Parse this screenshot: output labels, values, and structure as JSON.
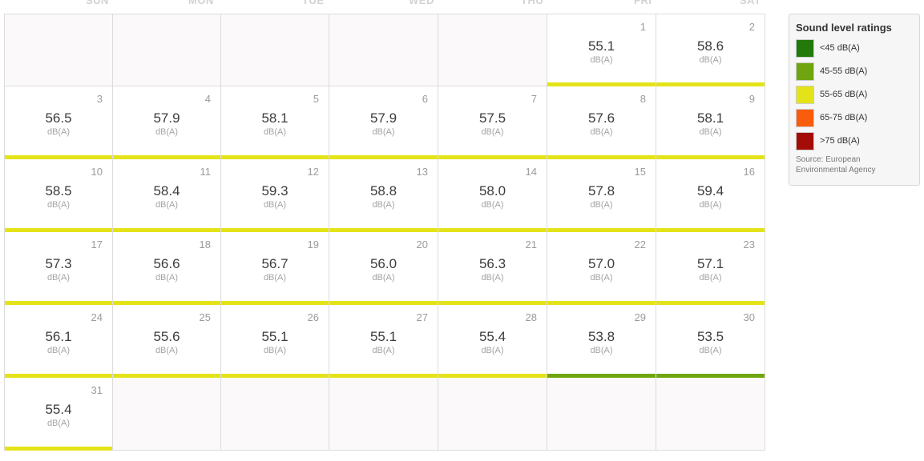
{
  "calendar": {
    "weekdays": [
      "SUN",
      "MON",
      "TUE",
      "WED",
      "THU",
      "FRI",
      "SAT"
    ],
    "unit": "dB(A)",
    "leading_blank_days": 5,
    "days": [
      {
        "day": "1",
        "value": "55.1",
        "rating": "55-65 dB(A)"
      },
      {
        "day": "2",
        "value": "58.6",
        "rating": "55-65 dB(A)"
      },
      {
        "day": "3",
        "value": "56.5",
        "rating": "55-65 dB(A)"
      },
      {
        "day": "4",
        "value": "57.9",
        "rating": "55-65 dB(A)"
      },
      {
        "day": "5",
        "value": "58.1",
        "rating": "55-65 dB(A)"
      },
      {
        "day": "6",
        "value": "57.9",
        "rating": "55-65 dB(A)"
      },
      {
        "day": "7",
        "value": "57.5",
        "rating": "55-65 dB(A)"
      },
      {
        "day": "8",
        "value": "57.6",
        "rating": "55-65 dB(A)"
      },
      {
        "day": "9",
        "value": "58.1",
        "rating": "55-65 dB(A)"
      },
      {
        "day": "10",
        "value": "58.5",
        "rating": "55-65 dB(A)"
      },
      {
        "day": "11",
        "value": "58.4",
        "rating": "55-65 dB(A)"
      },
      {
        "day": "12",
        "value": "59.3",
        "rating": "55-65 dB(A)"
      },
      {
        "day": "13",
        "value": "58.8",
        "rating": "55-65 dB(A)"
      },
      {
        "day": "14",
        "value": "58.0",
        "rating": "55-65 dB(A)"
      },
      {
        "day": "15",
        "value": "57.8",
        "rating": "55-65 dB(A)"
      },
      {
        "day": "16",
        "value": "59.4",
        "rating": "55-65 dB(A)"
      },
      {
        "day": "17",
        "value": "57.3",
        "rating": "55-65 dB(A)"
      },
      {
        "day": "18",
        "value": "56.6",
        "rating": "55-65 dB(A)"
      },
      {
        "day": "19",
        "value": "56.7",
        "rating": "55-65 dB(A)"
      },
      {
        "day": "20",
        "value": "56.0",
        "rating": "55-65 dB(A)"
      },
      {
        "day": "21",
        "value": "56.3",
        "rating": "55-65 dB(A)"
      },
      {
        "day": "22",
        "value": "57.0",
        "rating": "55-65 dB(A)"
      },
      {
        "day": "23",
        "value": "57.1",
        "rating": "55-65 dB(A)"
      },
      {
        "day": "24",
        "value": "56.1",
        "rating": "55-65 dB(A)"
      },
      {
        "day": "25",
        "value": "55.6",
        "rating": "55-65 dB(A)"
      },
      {
        "day": "26",
        "value": "55.1",
        "rating": "55-65 dB(A)"
      },
      {
        "day": "27",
        "value": "55.1",
        "rating": "55-65 dB(A)"
      },
      {
        "day": "28",
        "value": "55.4",
        "rating": "55-65 dB(A)"
      },
      {
        "day": "29",
        "value": "53.8",
        "rating": "45-55 dB(A)"
      },
      {
        "day": "30",
        "value": "53.5",
        "rating": "45-55 dB(A)"
      },
      {
        "day": "31",
        "value": "55.4",
        "rating": "55-65 dB(A)"
      }
    ]
  },
  "legend": {
    "title": "Sound level ratings",
    "items": [
      {
        "label": "<45 dB(A)",
        "color": "#237a0a"
      },
      {
        "label": "45-55 dB(A)",
        "color": "#6fa60f"
      },
      {
        "label": "55-65 dB(A)",
        "color": "#e4e319"
      },
      {
        "label": "65-75 dB(A)",
        "color": "#f95d0c"
      },
      {
        "label": ">75 dB(A)",
        "color": "#a40c07"
      }
    ],
    "source": "Source: European Environmental Agency"
  }
}
